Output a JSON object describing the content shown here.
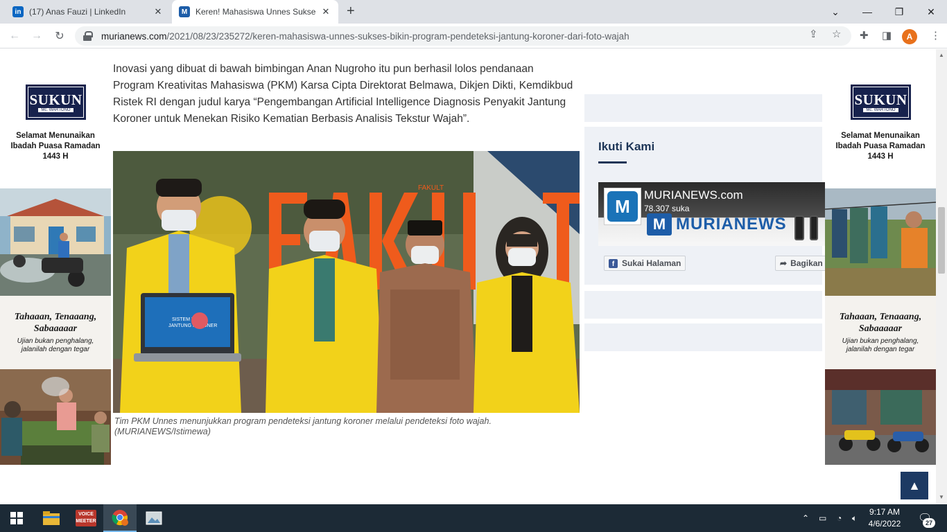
{
  "browser": {
    "tabs": [
      {
        "favicon": "in",
        "favicon_color": "#0a66c2",
        "title": "(17) Anas Fauzi | LinkedIn"
      },
      {
        "favicon": "M",
        "favicon_color": "#1d5da8",
        "title": "Keren! Mahasiswa Unnes Sukses"
      }
    ],
    "url_host": "murianews.com",
    "url_path": "/2021/08/23/235272/keren-mahasiswa-unnes-sukses-bikin-program-pendeteksi-jantung-koroner-dari-foto-wajah",
    "profile_initial": "A"
  },
  "ads": {
    "brand": "SUKUN",
    "brand_sub": "Mc. WARTONO",
    "greeting": [
      "Selamat Menunaikan",
      "Ibadah Puasa Ramadan",
      "1443 H"
    ],
    "tagline": [
      "Tahaaan, Tenaaang,",
      "Sabaaaaar"
    ],
    "subtagline": [
      "Ujian bukan penghalang,",
      "jalanilah dengan tegar"
    ]
  },
  "article": {
    "paragraph": "Inovasi yang dibuat di bawah bimbingan Anan Nugroho itu pun berhasil lolos pendanaan Program Kreativitas Mahasiswa (PKM) Karsa Cipta Direktorat Belmawa, Dikjen Dikti, Kemdikbud Ristek RI dengan judul karya “Pengembangan Artificial Intelligence Diagnosis Penyakit Jantung Koroner untuk Menekan Risiko Kematian Berbasis Analisis Tekstur Wajah”.",
    "photo_sign": "FAKULT",
    "laptop_screen": [
      "SISTEM PAKAR",
      "JANTUNG KORONER"
    ],
    "caption": "Tim PKM Unnes menunjukkan program pendeteksi jantung koroner melalui pendeteksi foto wajah. (MURIANEWS/Istimewa)"
  },
  "sidebar": {
    "follow_title": "Ikuti Kami",
    "fb_page_name": "MURIANEWS.com",
    "fb_likes": "78.307 suka",
    "fb_cover_brand": "MURIANEWS",
    "like_button": "Sukai Halaman",
    "share_button": "Bagikan"
  },
  "taskbar": {
    "voicemeeter_label": [
      "VOICE",
      "MEETER"
    ],
    "time": "9:17 AM",
    "date": "4/6/2022",
    "notifications": "27"
  },
  "colors": {
    "accent_navy": "#1d3557",
    "sidebar_bg": "#eef1f6",
    "taskbar_bg": "#1c2a36",
    "jacket_yellow": "#f2d21a"
  }
}
